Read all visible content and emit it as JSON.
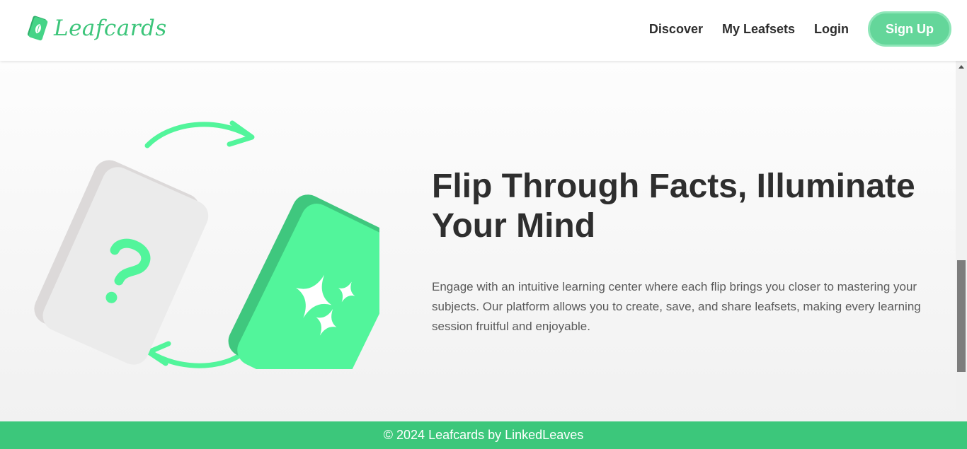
{
  "brand": {
    "name": "Leafcards",
    "icon": "leaf-card-icon"
  },
  "nav": {
    "discover": "Discover",
    "my_leafsets": "My Leafsets",
    "login": "Login",
    "signup": "Sign Up"
  },
  "hero": {
    "title": "Flip Through Facts, Illuminate Your Mind",
    "description": "Engage with an intuitive learning center where each flip brings you closer to mastering your subjects. Our platform allows you to create, save, and share leafsets, making every learning session fruitful and enjoyable.",
    "illustration": {
      "question_card_icon": "question-mark-icon",
      "answer_card_icon": "sparkles-icon",
      "arrows": "flip-arrows-icon"
    }
  },
  "footer": {
    "text": "© 2024 Leafcards by LinkedLeaves"
  },
  "colors": {
    "brand_green": "#3cc57a",
    "button_green": "#64d69a",
    "card_green": "#52f59b",
    "card_green_shadow": "#3fc77e",
    "card_gray": "#ececec",
    "footer_green": "#3cc77b",
    "title_text": "#2e2e2e"
  }
}
